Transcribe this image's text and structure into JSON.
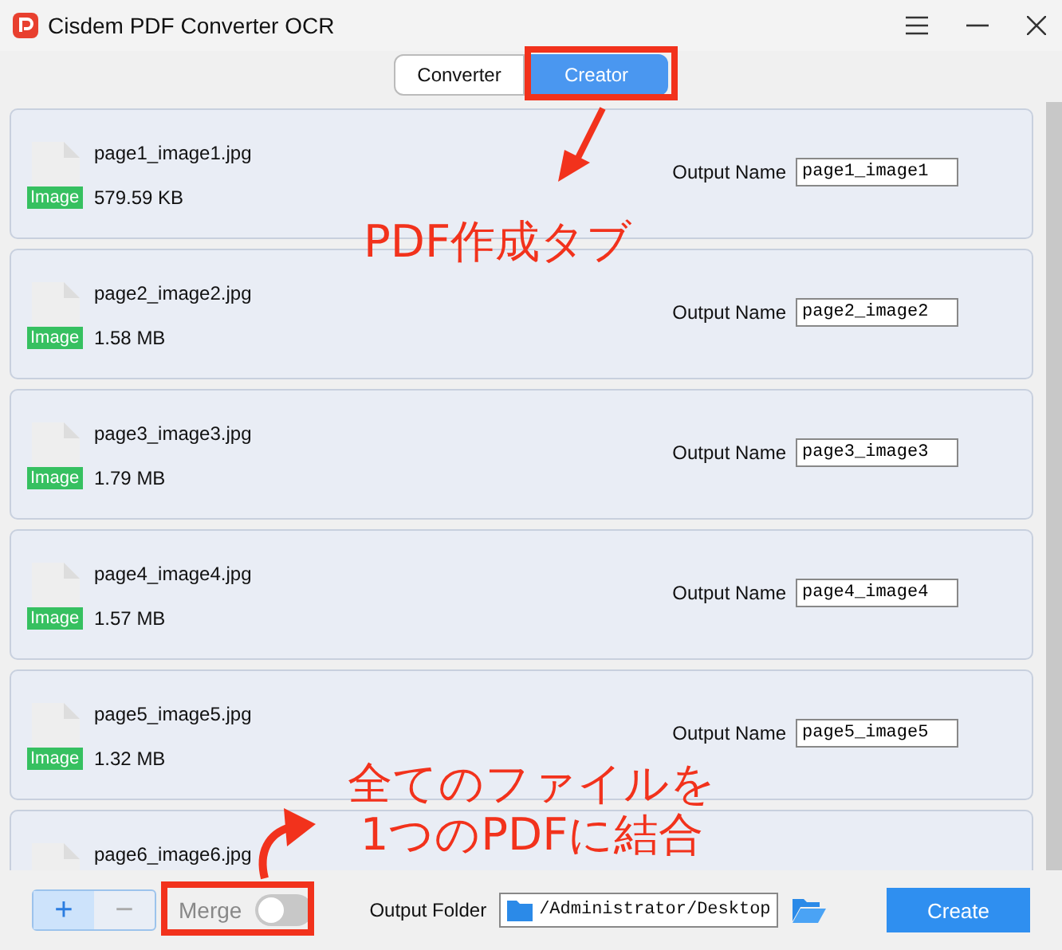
{
  "window": {
    "title": "Cisdem PDF Converter OCR"
  },
  "tabs": [
    {
      "label": "Converter",
      "selected": false
    },
    {
      "label": "Creator",
      "selected": true
    }
  ],
  "files": [
    {
      "name": "page1_image1.jpg",
      "badge": "Image",
      "size": "579.59 KB",
      "output_label": "Output Name",
      "output_name": "page1_image1"
    },
    {
      "name": "page2_image2.jpg",
      "badge": "Image",
      "size": "1.58 MB",
      "output_label": "Output Name",
      "output_name": "page2_image2"
    },
    {
      "name": "page3_image3.jpg",
      "badge": "Image",
      "size": "1.79 MB",
      "output_label": "Output Name",
      "output_name": "page3_image3"
    },
    {
      "name": "page4_image4.jpg",
      "badge": "Image",
      "size": "1.57 MB",
      "output_label": "Output Name",
      "output_name": "page4_image4"
    },
    {
      "name": "page5_image5.jpg",
      "badge": "Image",
      "size": "1.32 MB",
      "output_label": "Output Name",
      "output_name": "page5_image5"
    },
    {
      "name": "page6_image6.jpg"
    }
  ],
  "bottom_bar": {
    "add_button": {
      "label": "+",
      "disabled": false
    },
    "remove_button": {
      "label": "−",
      "disabled": true
    },
    "merge": {
      "label": "Merge",
      "on": false
    },
    "output_folder_label": "Output Folder",
    "output_folder": "/Administrator/Desktop",
    "create_button": "Create"
  },
  "annotations": [
    {
      "kind": "tab-callout",
      "text": "PDF作成タブ"
    },
    {
      "kind": "merge-callout",
      "lines": [
        "全てのファイルを",
        "1つのPDFに結合"
      ]
    }
  ]
}
